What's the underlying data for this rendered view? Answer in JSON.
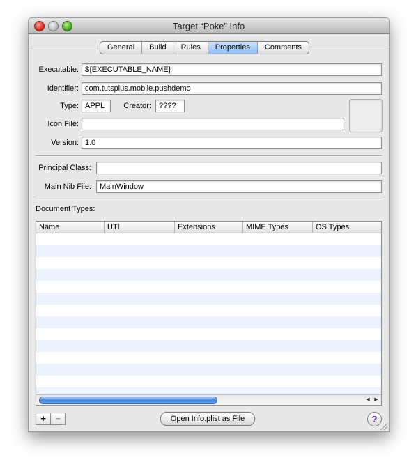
{
  "window": {
    "title": "Target “Poke” Info"
  },
  "tabs": [
    "General",
    "Build",
    "Rules",
    "Properties",
    "Comments"
  ],
  "active_tab": "Properties",
  "form": {
    "executable_label": "Executable:",
    "executable_value": "${EXECUTABLE_NAME}",
    "identifier_label": "Identifier:",
    "identifier_value": "com.tutsplus.mobile.pushdemo",
    "type_label": "Type:",
    "type_value": "APPL",
    "creator_label": "Creator:",
    "creator_value": "????",
    "iconfile_label": "Icon File:",
    "iconfile_value": "",
    "version_label": "Version:",
    "version_value": "1.0",
    "principal_label": "Principal Class:",
    "principal_value": "",
    "mainnib_label": "Main Nib File:",
    "mainnib_value": "MainWindow"
  },
  "document_types": {
    "label": "Document Types:",
    "columns": [
      "Name",
      "UTI",
      "Extensions",
      "MIME Types",
      "OS Types"
    ],
    "rows": []
  },
  "footer": {
    "add_label": "+",
    "remove_label": "−",
    "open_plist_label": "Open Info.plist as File",
    "help_label": "?"
  },
  "colors": {
    "selected_tab": "#8ebcf2",
    "stripe": "#edf3fe",
    "close": "#d1322a",
    "zoom": "#4aa51f"
  }
}
